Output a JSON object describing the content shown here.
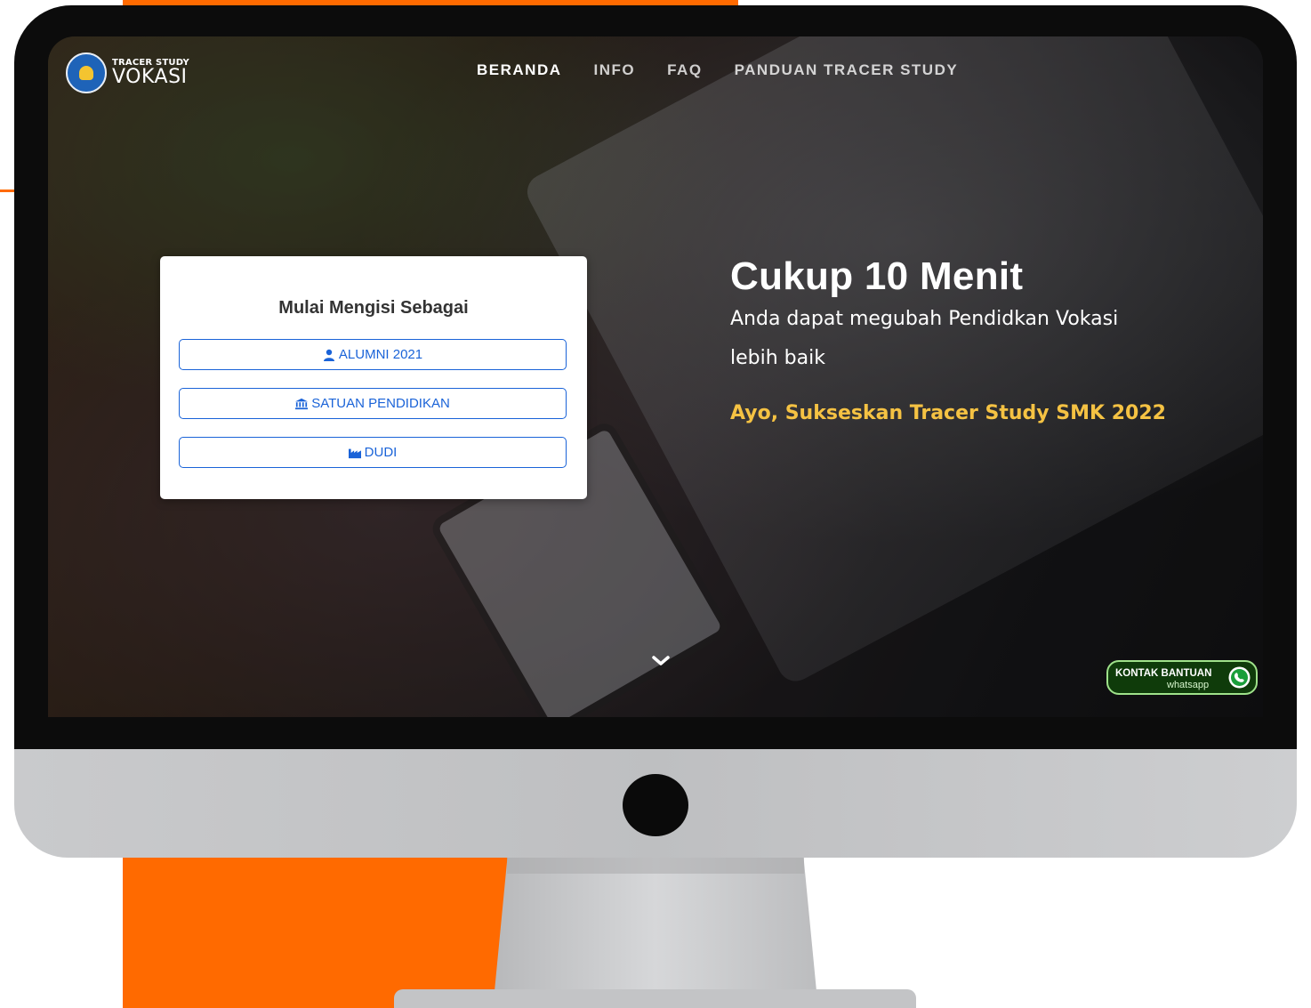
{
  "brand": {
    "small": "TRACER STUDY",
    "big": "VOKASI"
  },
  "nav": {
    "items": [
      {
        "label": "BERANDA",
        "active": true
      },
      {
        "label": "INFO",
        "active": false
      },
      {
        "label": "FAQ",
        "active": false
      },
      {
        "label": "PANDUAN TRACER STUDY",
        "active": false
      }
    ]
  },
  "card": {
    "title": "Mulai Mengisi Sebagai",
    "buttons": [
      {
        "label": "ALUMNI 2021",
        "icon": "user-icon"
      },
      {
        "label": "SATUAN PENDIDIKAN",
        "icon": "institution-icon"
      },
      {
        "label": "DUDI",
        "icon": "industry-icon"
      }
    ]
  },
  "hero": {
    "title": "Cukup 10 Menit",
    "subtitle": "Anda dapat megubah Pendidkan Vokasi lebih baik",
    "cta": "Ayo, Sukseskan Tracer Study SMK 2022"
  },
  "whatsapp": {
    "label": "KONTAK BANTUAN",
    "sub": "whatsapp",
    "icon": "whatsapp-icon"
  },
  "colors": {
    "accent_orange": "#ff6a00",
    "button_blue": "#1a63d8",
    "cta_yellow": "#f5c243",
    "whatsapp_green": "#0f3b0a"
  }
}
